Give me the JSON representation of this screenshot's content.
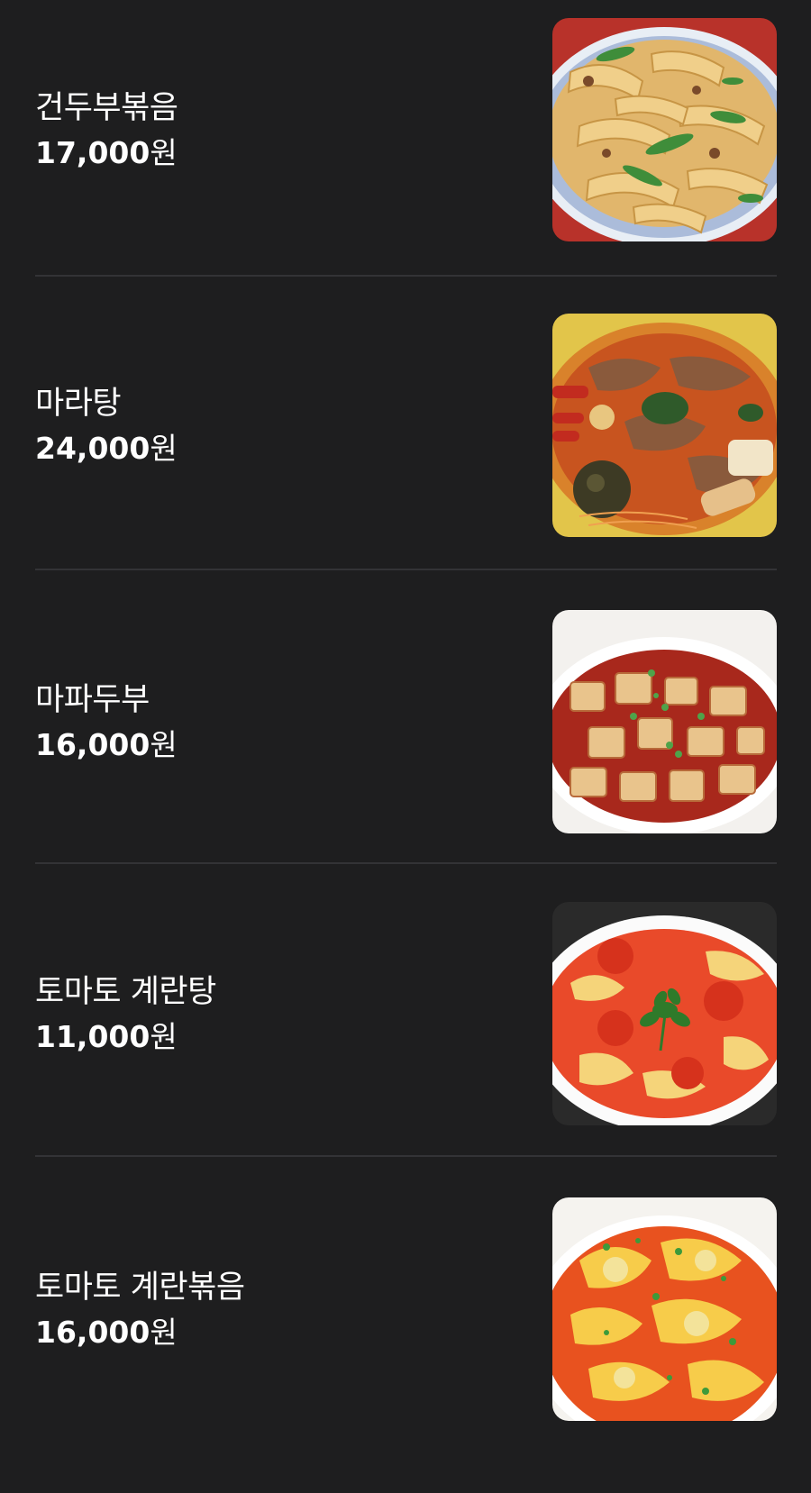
{
  "menu": {
    "items": [
      {
        "name": "건두부볶음",
        "price": "17,000",
        "unit": "원",
        "photo": "dried-tofu-stir-fry-photo"
      },
      {
        "name": "마라탕",
        "price": "24,000",
        "unit": "원",
        "photo": "malatang-photo"
      },
      {
        "name": "마파두부",
        "price": "16,000",
        "unit": "원",
        "photo": "mapo-tofu-photo"
      },
      {
        "name": "토마토 계란탕",
        "price": "11,000",
        "unit": "원",
        "photo": "tomato-egg-soup-photo"
      },
      {
        "name": "토마토 계란볶음",
        "price": "16,000",
        "unit": "원",
        "photo": "tomato-egg-stir-fry-photo"
      }
    ]
  },
  "colors": {
    "background": "#1e1e1f",
    "text": "#ffffff",
    "divider": "#333336"
  }
}
